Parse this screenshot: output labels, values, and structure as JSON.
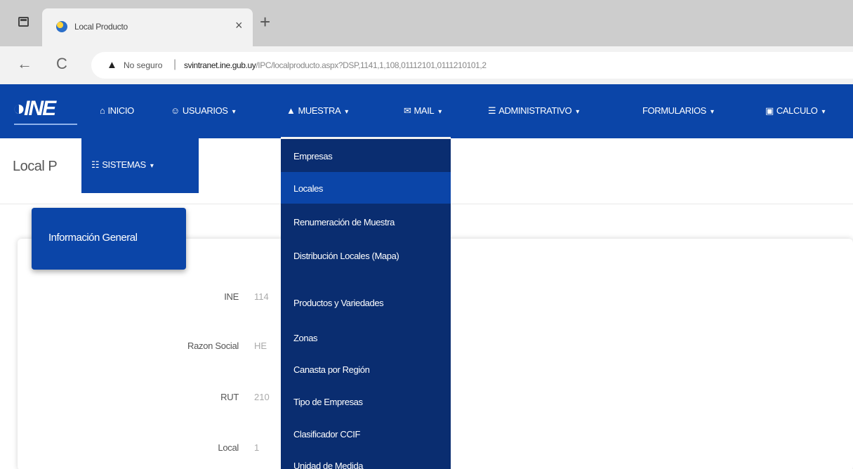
{
  "browser": {
    "tab_title": "Local Producto",
    "tab_close": "×",
    "new_tab": "+",
    "back": "←",
    "reload": "C",
    "not_secure": "No seguro",
    "url_sep": "|",
    "url_host": "svintranet.ine.gub.uy",
    "url_path": "/IPC/localproducto.aspx?DSP,1141,1,108,01112101,0111210101,2"
  },
  "navbar": {
    "logo": "INE",
    "items": [
      {
        "label": "INICIO",
        "icon": "home-icon",
        "glyph": "⌂",
        "caret": ""
      },
      {
        "label": "USUARIOS",
        "icon": "users-icon",
        "glyph": "☺",
        "caret": "▾"
      },
      {
        "label": "MUESTRA",
        "icon": "building-icon",
        "glyph": "▲",
        "caret": "▾"
      },
      {
        "label": "MAIL",
        "icon": "mail-icon",
        "glyph": "✉",
        "caret": "▾"
      },
      {
        "label": "ADMINISTRATIVO",
        "icon": "list-icon",
        "glyph": "☰",
        "caret": "▾"
      },
      {
        "label": "FORMULARIOS",
        "icon": "",
        "glyph": "",
        "caret": "▾"
      },
      {
        "label": "CALCULO",
        "icon": "calculator-icon",
        "glyph": "▣",
        "caret": "▾"
      }
    ],
    "sistemas": {
      "label": "SISTEMAS",
      "icon": "sitemap-icon",
      "glyph": "☷",
      "caret": "▾"
    }
  },
  "dropdown": {
    "items": [
      "Empresas",
      "Locales",
      "Renumeración de Muestra",
      "Distribución Locales (Mapa)",
      "Productos y Variedades",
      "Zonas",
      "Canasta por Región",
      "Tipo de Empresas",
      "Clasificador CCIF",
      "Unidad de Medida"
    ],
    "active": "Locales"
  },
  "page": {
    "title": "Local P",
    "card_tab": "Información General",
    "fields": [
      {
        "label": "INE",
        "value": "114"
      },
      {
        "label": "Razon Social",
        "value": "HE"
      },
      {
        "label": "RUT",
        "value": "210"
      },
      {
        "label": "Local",
        "value": "1"
      }
    ]
  }
}
